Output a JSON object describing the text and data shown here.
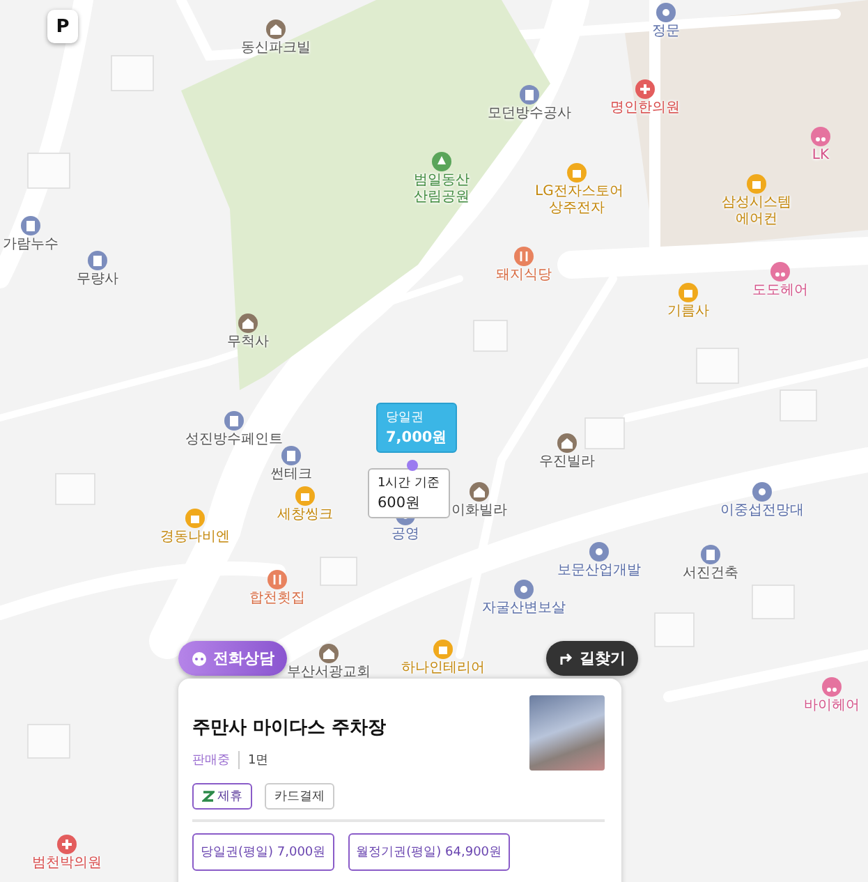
{
  "parking_toggle": {
    "label": "P"
  },
  "map": {
    "pois": [
      {
        "name": "동신파크빌",
        "kind": "residence"
      },
      {
        "name": "정문",
        "kind": "landmark"
      },
      {
        "name": "명인한의원",
        "kind": "hospital"
      },
      {
        "name": "모던방수공사",
        "kind": "company"
      },
      {
        "name": "범일동산 산림공원",
        "kind": "park"
      },
      {
        "name": "LK",
        "kind": "beauty"
      },
      {
        "name": "LG전자스토어 상주전자",
        "kind": "shop"
      },
      {
        "name": "삼성시스템 에어컨",
        "kind": "shop"
      },
      {
        "name": "가람누수",
        "kind": "company"
      },
      {
        "name": "무량사",
        "kind": "company"
      },
      {
        "name": "돼지식당",
        "kind": "food"
      },
      {
        "name": "기름사",
        "kind": "shop"
      },
      {
        "name": "도도헤어",
        "kind": "beauty"
      },
      {
        "name": "무척사",
        "kind": "temple"
      },
      {
        "name": "성진방수페인트",
        "kind": "company"
      },
      {
        "name": "썬테크",
        "kind": "company"
      },
      {
        "name": "세창씽크",
        "kind": "shop"
      },
      {
        "name": "경동나비엔",
        "kind": "shop"
      },
      {
        "name": "우진빌라",
        "kind": "residence"
      },
      {
        "name": "이화빌라",
        "kind": "residence"
      },
      {
        "name": "공영",
        "kind": "landmark"
      },
      {
        "name": "이중섭전망대",
        "kind": "landmark"
      },
      {
        "name": "합천횟집",
        "kind": "food"
      },
      {
        "name": "보문산업개발",
        "kind": "landmark"
      },
      {
        "name": "서진건축",
        "kind": "company"
      },
      {
        "name": "자굴산변보살",
        "kind": "landmark"
      },
      {
        "name": "부산서광교회",
        "kind": "residence"
      },
      {
        "name": "하나인테리어",
        "kind": "shop"
      },
      {
        "name": "바이헤어",
        "kind": "beauty"
      },
      {
        "name": "범천박의원",
        "kind": "hospital"
      }
    ]
  },
  "price_markers": [
    {
      "kind": "primary",
      "label": "당일권",
      "price": "7,000원"
    },
    {
      "kind": "secondary",
      "label": "1시간 기준",
      "price": "600원"
    }
  ],
  "call_button": {
    "label": "전화상담"
  },
  "directions_button": {
    "label": "길찾기"
  },
  "card": {
    "title": "주만사 마이다스 주차장",
    "status": "판매중",
    "spaces": "1면",
    "tags": [
      {
        "label": "제휴",
        "kind": "partner"
      },
      {
        "label": "카드결제",
        "kind": "plain"
      }
    ],
    "tickets": [
      "당일권(평일) 7,000원",
      "월정기권(평일) 64,900원"
    ]
  }
}
